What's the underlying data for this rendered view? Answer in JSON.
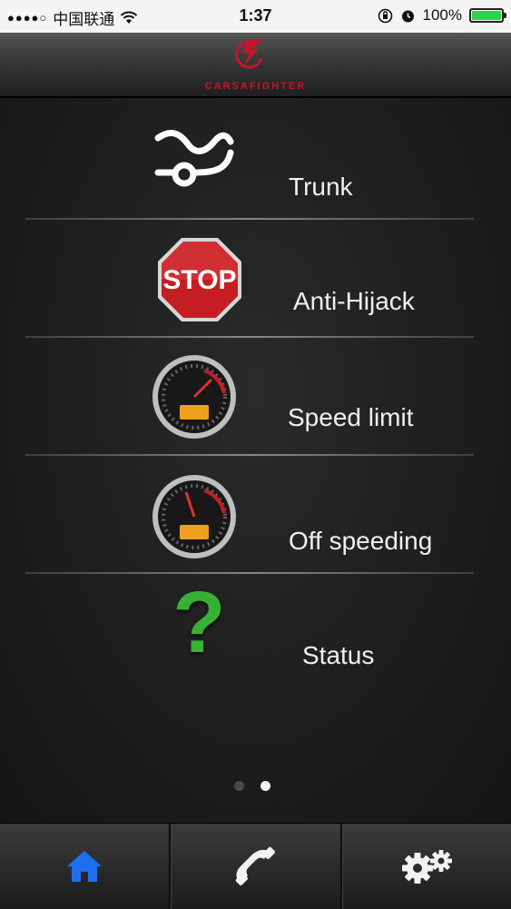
{
  "status_bar": {
    "signal": "●●●●○",
    "carrier": "中国联通",
    "time": "1:37",
    "battery": "100%",
    "battery_level": 1.0
  },
  "header": {
    "brand": "CARSAFIGHTER"
  },
  "menu": {
    "items": [
      {
        "label": "Trunk",
        "icon": "trunk-icon"
      },
      {
        "label": "Anti-Hijack",
        "icon": "stop-sign-icon"
      },
      {
        "label": "Speed limit",
        "icon": "speedometer-icon"
      },
      {
        "label": "Off speeding",
        "icon": "speedometer-icon"
      },
      {
        "label": "Status",
        "icon": "question-mark-icon"
      }
    ],
    "stop_text": "STOP",
    "question_text": "?"
  },
  "pager": {
    "pages": 2,
    "current": 2
  },
  "tabbar": {
    "tabs": [
      {
        "icon": "home-icon",
        "active": true
      },
      {
        "icon": "phone-icon",
        "active": false
      },
      {
        "icon": "settings-gears-icon",
        "active": false
      }
    ]
  },
  "colors": {
    "brand_red": "#c8142a",
    "active_tab": "#1e6ff0",
    "battery_green": "#2bd34a",
    "question_green": "#35b233"
  }
}
